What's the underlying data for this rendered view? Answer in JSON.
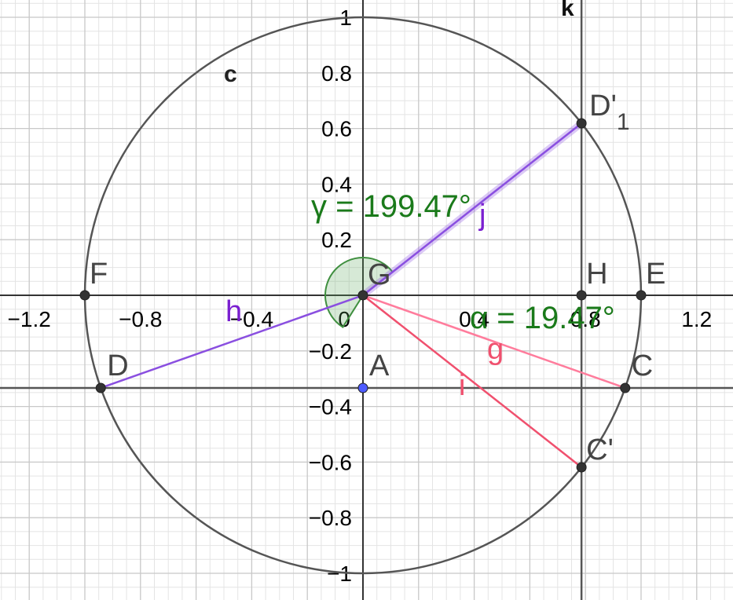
{
  "axes": {
    "x_ticks": [
      "−1.2",
      "−0.8",
      "−0.4",
      "0",
      "0.4",
      "0.8",
      "1.2"
    ],
    "x_tick_values": [
      -1.2,
      -0.8,
      -0.4,
      0,
      0.4,
      0.8,
      1.2
    ],
    "y_ticks": [
      "1",
      "0.8",
      "0.6",
      "0.4",
      "0.2",
      "−0.2",
      "−0.4",
      "−0.6",
      "−0.8",
      "−1"
    ],
    "y_tick_values": [
      1,
      0.8,
      0.6,
      0.4,
      0.2,
      -0.2,
      -0.4,
      -0.6,
      -0.8,
      -1
    ],
    "x_range": [
      -1.3,
      1.33
    ],
    "y_range": [
      -1.09,
      1.06
    ],
    "minor_grid_step": 0.05,
    "major_grid_step": 0.2
  },
  "circle": {
    "name": "c",
    "cx": 0,
    "cy": 0,
    "r": 1,
    "color": "#555555"
  },
  "lines": [
    {
      "name": "k",
      "kind": "vertical",
      "value": 0.7857,
      "color": "#555555"
    },
    {
      "name": "",
      "kind": "horizontal",
      "value": -0.3333,
      "color": "#555555"
    }
  ],
  "points": [
    {
      "name": "G",
      "x": 0,
      "y": 0,
      "color": "#333333"
    },
    {
      "name": "F",
      "x": -1,
      "y": 0,
      "color": "#333333"
    },
    {
      "name": "E",
      "x": 1,
      "y": 0,
      "color": "#333333"
    },
    {
      "name": "H",
      "x": 0.7857,
      "y": 0,
      "color": "#333333"
    },
    {
      "name": "D",
      "x": -0.9428,
      "y": -0.3333,
      "color": "#333333"
    },
    {
      "name": "C",
      "x": 0.9428,
      "y": -0.3333,
      "color": "#333333"
    },
    {
      "name": "C'",
      "x": 0.7857,
      "y": -0.6186,
      "color": "#333333"
    },
    {
      "name": "D'",
      "sub": "1",
      "x": 0.7857,
      "y": 0.6186,
      "color": "#333333"
    },
    {
      "name": "A",
      "x": 0,
      "y": -0.3333,
      "color": "#4d5bff"
    }
  ],
  "segments": [
    {
      "name": "h",
      "from": "D",
      "to": "G",
      "color": "#8a4fe0"
    },
    {
      "name": "j",
      "from": "G",
      "to": "D'",
      "color": "#8a4fe0"
    },
    {
      "name": "g",
      "from": "G",
      "to": "C",
      "color": "#ff7c9c"
    },
    {
      "name": "i",
      "from": "G",
      "to": "C'",
      "color": "#f0506e"
    }
  ],
  "angles": [
    {
      "name": "γ",
      "label": "γ = 199.47°",
      "value_deg": 199.47,
      "color": "#1a7a1a"
    },
    {
      "name": "α",
      "label": "α = 19.47°",
      "value_deg": 19.47,
      "color": "#1a7a1a"
    }
  ],
  "colors": {
    "grid_minor": "#e4e4e4",
    "grid_major": "#c8c8c8",
    "axis": "#333333",
    "angle_fill": "#5aa85a",
    "segment_purple": "#8a4fe0",
    "segment_pink": "#ff7c9c",
    "segment_red": "#f0506e",
    "label_purple": "#7a1fd0",
    "label_pink": "#f0506e",
    "label_green": "#1a7a1a",
    "label_blue": "#4d5bff"
  }
}
